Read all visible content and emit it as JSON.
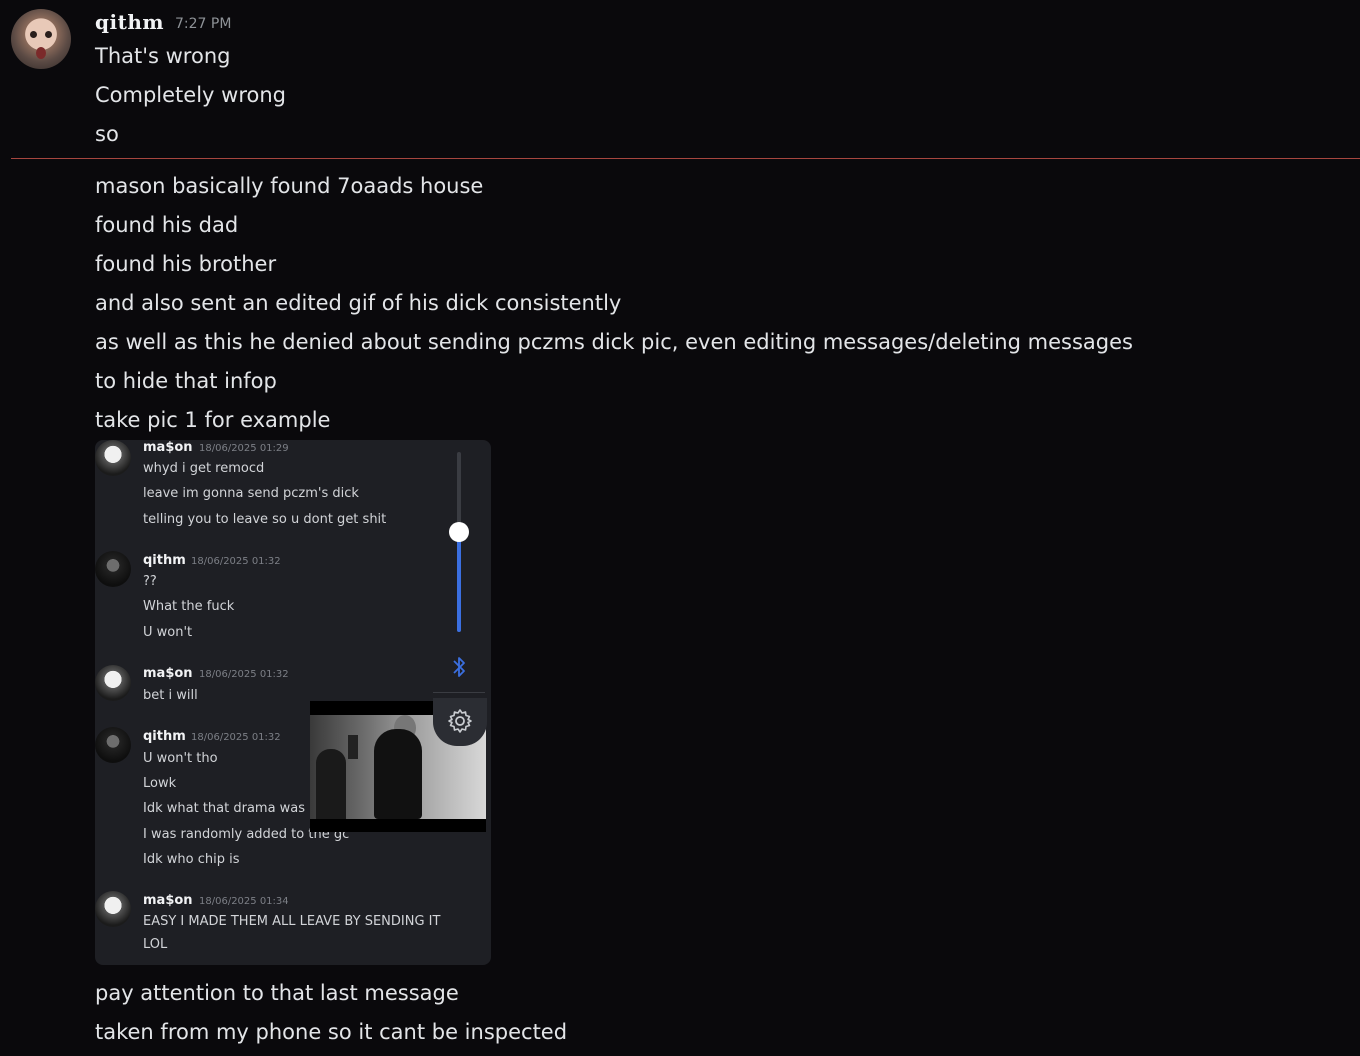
{
  "message": {
    "username": "qithm",
    "timestamp": "7:27 PM",
    "lines_before_divider": [
      "That's wrong",
      "Completely wrong",
      "so"
    ],
    "lines_after_divider": [
      "mason basically found 7oaads house",
      "found his dad",
      "found his brother",
      "and also sent an edited gif of his dick  consistently",
      "as well as this he denied about sending pczms dick pic, even editing messages/deleting messages",
      "to hide that infop",
      "take pic 1 for example"
    ],
    "lines_after_image": [
      "pay attention to that last message",
      "taken from my phone so it cant be inspected"
    ]
  },
  "divider_color": "#a6463f",
  "attachment": {
    "messages": [
      {
        "author": "ma$on",
        "time": "18/06/2025 01:29",
        "lines": [
          "whyd i get remocd",
          "leave im gonna send pczm's dick",
          "telling you to leave so u dont get shit"
        ]
      },
      {
        "author": "qithm",
        "time": "18/06/2025 01:32",
        "lines": [
          "??",
          "What the fuck",
          "U won't"
        ]
      },
      {
        "author": "ma$on",
        "time": "18/06/2025 01:32",
        "lines": [
          "bet i will"
        ]
      },
      {
        "author": "qithm",
        "time": "18/06/2025 01:32",
        "lines": [
          "U won't tho",
          "Lowk",
          "Idk what that drama was",
          "I was randomly added to the gc",
          "Idk who chip is"
        ]
      },
      {
        "author": "ma$on",
        "time": "18/06/2025 01:34",
        "lines": [
          "EASY I MADE THEM ALL LEAVE BY SENDING IT",
          "LOL"
        ]
      }
    ],
    "volume_level": 0.56,
    "accent_color": "#3b6fe0",
    "icons": [
      "bluetooth-icon",
      "gear-icon"
    ]
  }
}
